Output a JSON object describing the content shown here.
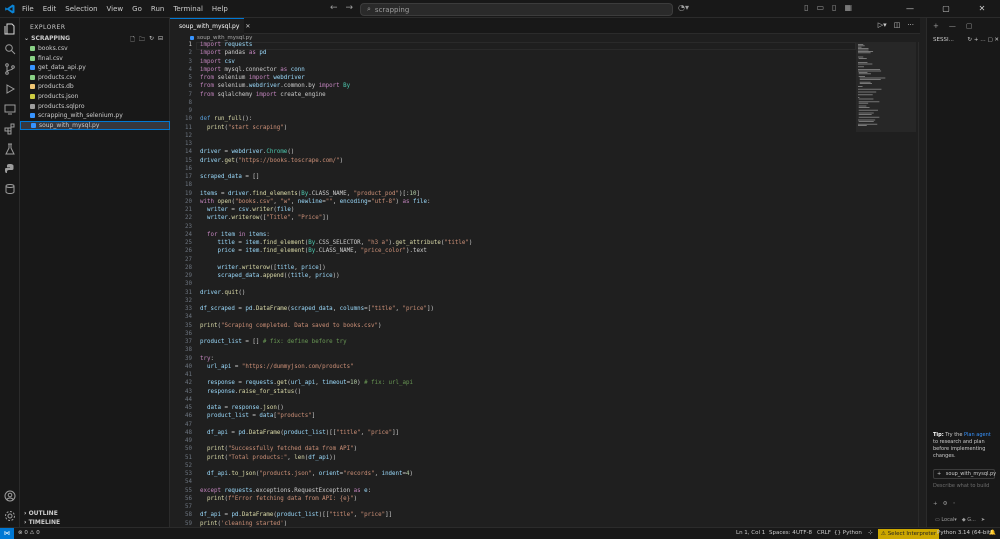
{
  "titlebar": {
    "menu": [
      "File",
      "Edit",
      "Selection",
      "View",
      "Go",
      "Run",
      "Terminal",
      "Help"
    ],
    "search_text": "scrapping"
  },
  "explorer": {
    "title": "EXPLORER",
    "folder": "SCRAPPING",
    "files": [
      {
        "name": "books.csv",
        "color": "#89d185"
      },
      {
        "name": "final.csv",
        "color": "#89d185"
      },
      {
        "name": "get_data_api.py",
        "color": "#3794ff"
      },
      {
        "name": "products.csv",
        "color": "#89d185"
      },
      {
        "name": "products.db",
        "color": "#f0c674"
      },
      {
        "name": "products.json",
        "color": "#cbcb41"
      },
      {
        "name": "products.sqlpro",
        "color": "#9d9d9d"
      },
      {
        "name": "scrapping_with_selenium.py",
        "color": "#3794ff"
      },
      {
        "name": "soup_with_mysql.py",
        "color": "#3794ff"
      }
    ],
    "outline": "OUTLINE",
    "timeline": "TIMELINE"
  },
  "editor": {
    "tab": "soup_with_mysql.py",
    "breadcrumb": "soup_with_mysql.py",
    "lines": [
      "import requests",
      "import pandas as pd",
      "import csv",
      "import mysql.connector as conn",
      "from selenium import webdriver",
      "from selenium.webdriver.common.by import By",
      "from sqlalchemy import create_engine",
      "",
      "",
      "def run_full():",
      "  print(\"start scraping\")",
      "",
      "",
      "driver = webdriver.Chrome()",
      "driver.get(\"https://books.toscrape.com/\")",
      "",
      "scraped_data = []",
      "",
      "items = driver.find_elements(By.CLASS_NAME, \"product_pod\")[:10]",
      "with open(\"books.csv\", \"w\", newline=\"\", encoding=\"utf-8\") as file:",
      "  writer = csv.writer(file)",
      "  writer.writerow([\"Title\", \"Price\"])",
      "",
      "  for item in items:",
      "     title = item.find_element(By.CSS_SELECTOR, \"h3 a\").get_attribute(\"title\")",
      "     price = item.find_element(By.CLASS_NAME, \"price_color\").text",
      "",
      "     writer.writerow([title, price])",
      "     scraped_data.append((title, price))",
      "",
      "driver.quit()",
      "",
      "df_scraped = pd.DataFrame(scraped_data, columns=[\"title\", \"price\"])",
      "",
      "print(\"Scraping completed. Data saved to books.csv\")",
      "",
      "product_list = [] # fix: define before try",
      "",
      "try:",
      "  url_api = \"https://dummyjson.com/products\"",
      "",
      "  response = requests.get(url_api, timeout=10) # fix: url_api",
      "  response.raise_for_status()",
      "",
      "  data = response.json()",
      "  product_list = data[\"products\"]",
      "",
      "  df_api = pd.DataFrame(product_list)[[\"title\", \"price\"]]",
      "",
      "  print(\"Successfully fetched data from API\")",
      "  print(\"Total products:\", len(df_api))",
      "",
      "  df_api.to_json(\"products.json\", orient=\"records\", indent=4)",
      "",
      "except requests.exceptions.RequestException as e:",
      "  print(f\"Error fetching data from API: {e}\")",
      "",
      "df_api = pd.DataFrame(product_list)[[\"title\", \"price\"]]",
      "print('cleaning started')"
    ]
  },
  "chat": {
    "header": "SESSI...",
    "tip_prefix": "Tip:",
    "tip_mid": "Try the",
    "tip_link": "Plan agent",
    "tip_rest": "to research and plan before implementing changes.",
    "context_file": "soup_with_mysql.py",
    "input_placeholder": "Describe what to build",
    "mode_label": "Local",
    "model_label": "G..."
  },
  "status": {
    "errors": "0",
    "warnings": "0",
    "position": "Ln 1, Col 1",
    "spaces": "Spaces: 4",
    "encoding": "UTF-8",
    "eol": "CRLF",
    "language": "Python",
    "interpreter_label": "Select Interpreter",
    "python_version": "Python 3.14 (64-bit)"
  },
  "colors": {
    "accent": "#0078d4",
    "editor_bg": "#1f1f1f",
    "chrome_bg": "#181818",
    "warning_bg": "#cca700"
  }
}
